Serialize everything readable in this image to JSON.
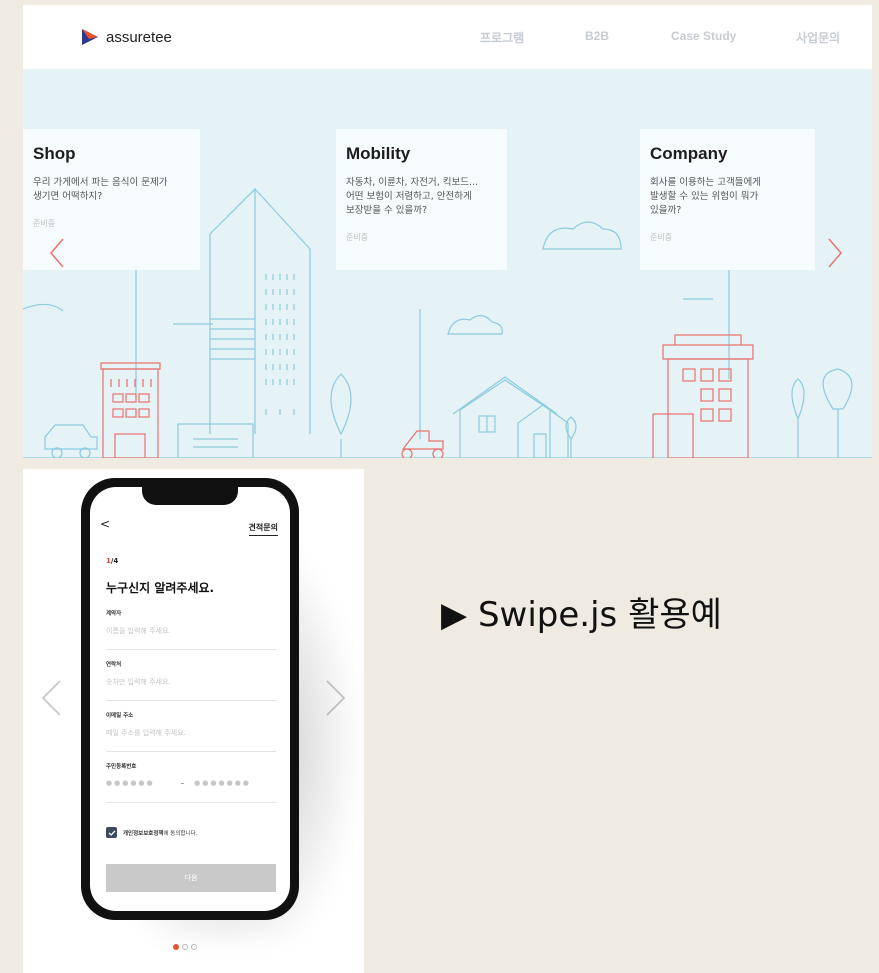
{
  "nav": {
    "logo_text": "assuretee",
    "items": [
      "프로그램",
      "B2B",
      "Case Study",
      "사업문의"
    ]
  },
  "cards": [
    {
      "title": "Shop",
      "desc": "우리 가게에서 파는 음식이 문제가\n생기면 어떡하지?",
      "status": "준비중"
    },
    {
      "title": "Mobility",
      "desc": "자동차, 이륜차, 자전거, 킥보드...\n어떤 보험이 저렴하고, 안전하게\n보장받을 수 있을까?",
      "status": "준비중"
    },
    {
      "title": "Company",
      "desc": "회사를 이용하는 고객들에게\n발생할 수 있는 위험이 뭐가\n있을까?",
      "status": "준비중"
    }
  ],
  "phone": {
    "back": "<",
    "header_link": "견적문의",
    "step_current": "1",
    "step_total": "/4",
    "title": "누구신지 알려주세요.",
    "fields": [
      {
        "label": "계약자",
        "placeholder": "이름을 입력해 주세요."
      },
      {
        "label": "연락처",
        "placeholder": "숫자만 입력해 주세요."
      },
      {
        "label": "이메일 주소",
        "placeholder": "메일 주소를 입력해 주세요."
      }
    ],
    "rrn": {
      "label": "주민등록번호",
      "front": "●●●●●●",
      "dash": "–",
      "back": "●●●●●●●"
    },
    "agree_bold": "개인정보보호정책",
    "agree_rest": "에 동의합니다.",
    "next": "다음"
  },
  "carousel": {
    "pages": 3,
    "active_page": 1
  },
  "caption": "▶ Swipe.js 활용예",
  "colors": {
    "accent": "#e4532b",
    "line_blue": "#8ccbe0",
    "line_red": "#e9726d"
  }
}
